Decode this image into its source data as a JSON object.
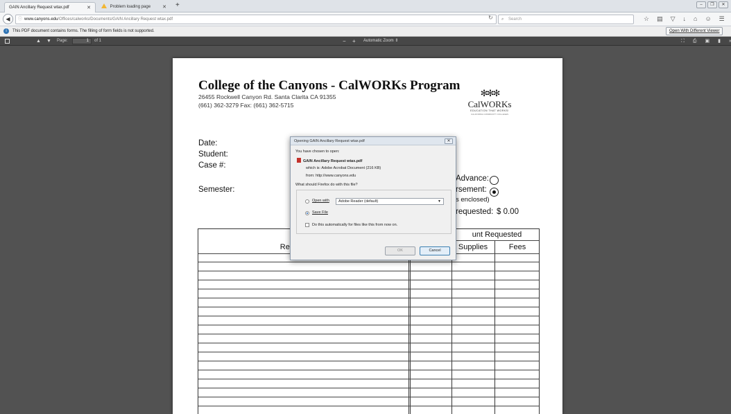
{
  "browser": {
    "tabs": [
      {
        "label": "GAIN Ancillary Request wtax.pdf",
        "active": true
      },
      {
        "label": "Problem loading page",
        "active": false
      }
    ],
    "new_tab": "+",
    "window_controls": [
      "–",
      "❐",
      "✕"
    ],
    "url_host": "www.canyons.edu",
    "url_path": "/Offices/calworks/Documents/GAIN Ancillary Request wtax.pdf",
    "search_placeholder": "Search",
    "toolbar_icons": [
      "star-icon",
      "reading-list-icon",
      "pocket-icon",
      "download-icon",
      "home-icon",
      "sync-icon",
      "menu-icon"
    ]
  },
  "notification": {
    "text": "This PDF document contains forms. The filling of form fields is not supported.",
    "button": "Open With Different Viewer"
  },
  "pdf_toolbar": {
    "page_label": "Page:",
    "page_number": "1",
    "page_of": "of 1",
    "zoom_out": "−",
    "zoom_in": "+",
    "zoom": "Automatic Zoom"
  },
  "document": {
    "title": "College of the Canyons - CalWORKs Program",
    "address": "26455 Rockwell Canyon Rd.  Santa Clarita  CA  91355",
    "phone": "(661) 362-3279      Fax: (661) 362-5715",
    "logo_text": "CalWORKs",
    "logo_tag": "EDUCATION THAT WORKS!",
    "logo_sub": "CALIFORNIA COMMUNITY COLLEGES",
    "labels": {
      "date": "Date:",
      "student": "Student:",
      "case": "Case #:",
      "semester": "Semester:",
      "advance": "Advance:",
      "reimbursement": "rsement:",
      "enclosed": "s enclosed)",
      "requested": "requested:",
      "requested_amount": "$ 0.00"
    },
    "table": {
      "header_top": "unt Requested",
      "col_request": "Request for G",
      "col_supplies": "Supplies",
      "col_fees": "Fees"
    }
  },
  "dialog": {
    "title": "Opening GAIN Ancillary Request wtax.pdf",
    "close": "✕",
    "chosen": "You have chosen to open:",
    "filename": "GAIN Ancillary Request wtax.pdf",
    "which_is_label": "which is:",
    "which_is": "Adobe Acrobat Document (216 KB)",
    "from_label": "from:",
    "from": "http://www.canyons.edu",
    "question": "What should Firefox do with this file?",
    "open_with": "Open with",
    "open_with_app": "Adobe Reader (default)",
    "save_file": "Save File",
    "auto": "Do this automatically for files like this from now on.",
    "ok": "OK",
    "cancel": "Cancel"
  }
}
